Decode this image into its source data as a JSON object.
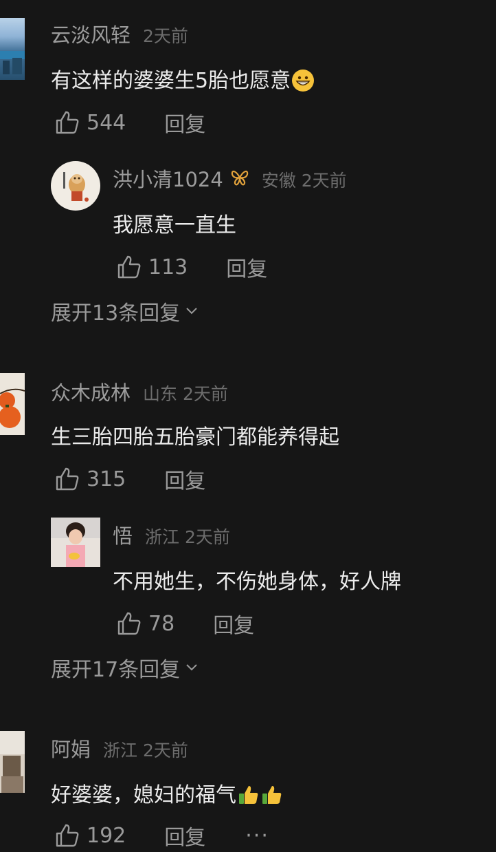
{
  "comments": [
    {
      "name": "云淡风轻",
      "meta": "2天前",
      "text": "有这样的婆婆生5胎也愿意",
      "emoji": "grinning-emoji",
      "likes": "544",
      "reply": "回复",
      "sub": {
        "name": "洪小清1024",
        "meta": "安徽 2天前",
        "text": "我愿意一直生",
        "likes": "113",
        "reply": "回复"
      },
      "expand": "展开13条回复"
    },
    {
      "name": "众木成林",
      "meta": "山东 2天前",
      "text": "生三胎四胎五胎豪门都能养得起",
      "likes": "315",
      "reply": "回复",
      "sub": {
        "name": "悟",
        "meta": "浙江 2天前",
        "text": "不用她生，不伤她身体，好人牌",
        "likes": "78",
        "reply": "回复"
      },
      "expand": "展开17条回复"
    },
    {
      "name": "阿娟",
      "meta": "浙江 2天前",
      "text": "好婆婆，媳妇的福气",
      "emoji": "thumbs-up-emoji",
      "likes": "192",
      "reply": "回复",
      "more": "···"
    }
  ],
  "icons": {
    "like": "thumbs-up-outline-icon",
    "expand": "chevron-down-icon",
    "verified": "butterfly-badge-icon"
  },
  "colors": {
    "background": "#161616",
    "name": "#9c9c9c",
    "meta": "#6d6d6d",
    "text": "#ececec",
    "action": "#9a9a9a",
    "verified_badge": "#e2a23b"
  }
}
